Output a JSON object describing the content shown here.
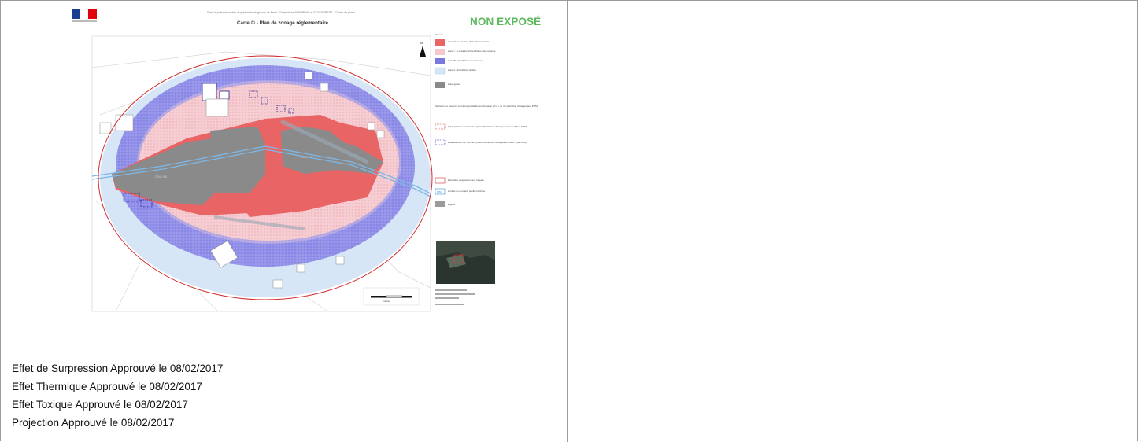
{
  "map": {
    "header_line": "Plan de prévention des risques technologiques de Brest - Entreprises IMPORDAL et STOCKBREST - Cahier de plans",
    "title": "Carte ① - Plan de zonage réglementaire",
    "status_label": "NON EXPOSÉ",
    "legend": {
      "zones_title": "Zones :",
      "zones": [
        {
          "label": "Zone R : à vocation d'interdiction stricte",
          "color": "#e96464"
        },
        {
          "label": "Zone r : à vocation d'interdiction sous réserve",
          "color": "#f6c9cf"
        },
        {
          "label": "Zone B : interdiction sous réserve",
          "color": "#7a79e0"
        },
        {
          "label": "Zone b : interdiction limitée",
          "color": "#d7e6f7"
        },
        {
          "label": "Zone grisée",
          "color": "#8a8a8a"
        }
      ],
      "measures_title": "Secteurs de mesures foncières possibles sur domaine privé / ou de restriction d'usages (sur DPM)",
      "measures": [
        {
          "label": "Expropriation sur domaine privé / Restriction d'usages en zone R (sur DPM)",
          "color": "#d12d2d"
        },
        {
          "label": "Délaissement sur domaine privé / Restriction d'usages en zone r (sur DPM)",
          "color": "#2c2cd1"
        }
      ],
      "others": [
        {
          "label": "Périmètre d'exposition aux risques",
          "color": "#d12d2d"
        },
        {
          "label": "Limites du domaine public maritime",
          "color": "#3a8fd6",
          "abbr": "DPM"
        },
        {
          "label": "Enjeux",
          "color": "#9b9b9b"
        }
      ]
    },
    "scale_label": "mètres",
    "colors": {
      "zone_R": "#e96464",
      "zone_r": "#f6c9cf",
      "zone_B": "#7a79e0",
      "zone_b": "#d7e6f7",
      "industrial": "#8a8a8a",
      "perimeter": "#d12d2d",
      "water": "#7fb8e6"
    }
  },
  "effects": [
    "Effet de Surpression Approuvé le 08/02/2017",
    "Effet Thermique Approuvé le 08/02/2017",
    "Effet Toxique Approuvé le 08/02/2017",
    "Projection Approuvé le 08/02/2017"
  ]
}
